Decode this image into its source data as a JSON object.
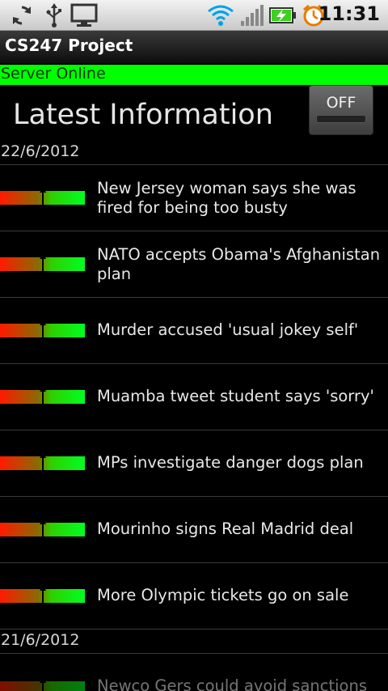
{
  "status_bar": {
    "clock": "11:31",
    "icons": [
      "sync-icon",
      "usb-icon",
      "monitor-icon",
      "wifi-icon",
      "signal-icon",
      "battery-charging-icon",
      "alarm-icon"
    ]
  },
  "app": {
    "title": "CS247 Project"
  },
  "server_status": "Server Online",
  "header": {
    "title": "Latest Information",
    "toggle_label": "OFF"
  },
  "sections": [
    {
      "date": "22/6/2012",
      "items": [
        {
          "headline": "New Jersey woman says she was fired for being too busty"
        },
        {
          "headline": "NATO accepts Obama's Afghanistan plan"
        },
        {
          "headline": "Murder accused 'usual jokey self'"
        },
        {
          "headline": "Muamba tweet student says 'sorry'"
        },
        {
          "headline": "MPs investigate danger dogs plan"
        },
        {
          "headline": "Mourinho signs Real Madrid deal"
        },
        {
          "headline": "More Olympic tickets go on sale"
        }
      ]
    },
    {
      "date": "21/6/2012",
      "items": [
        {
          "headline": "Newco Gers could avoid sanctions"
        }
      ]
    }
  ],
  "colors": {
    "accent_green": "#00ff00",
    "gauge_red": "#ff1a00",
    "gauge_green": "#00ff22"
  }
}
